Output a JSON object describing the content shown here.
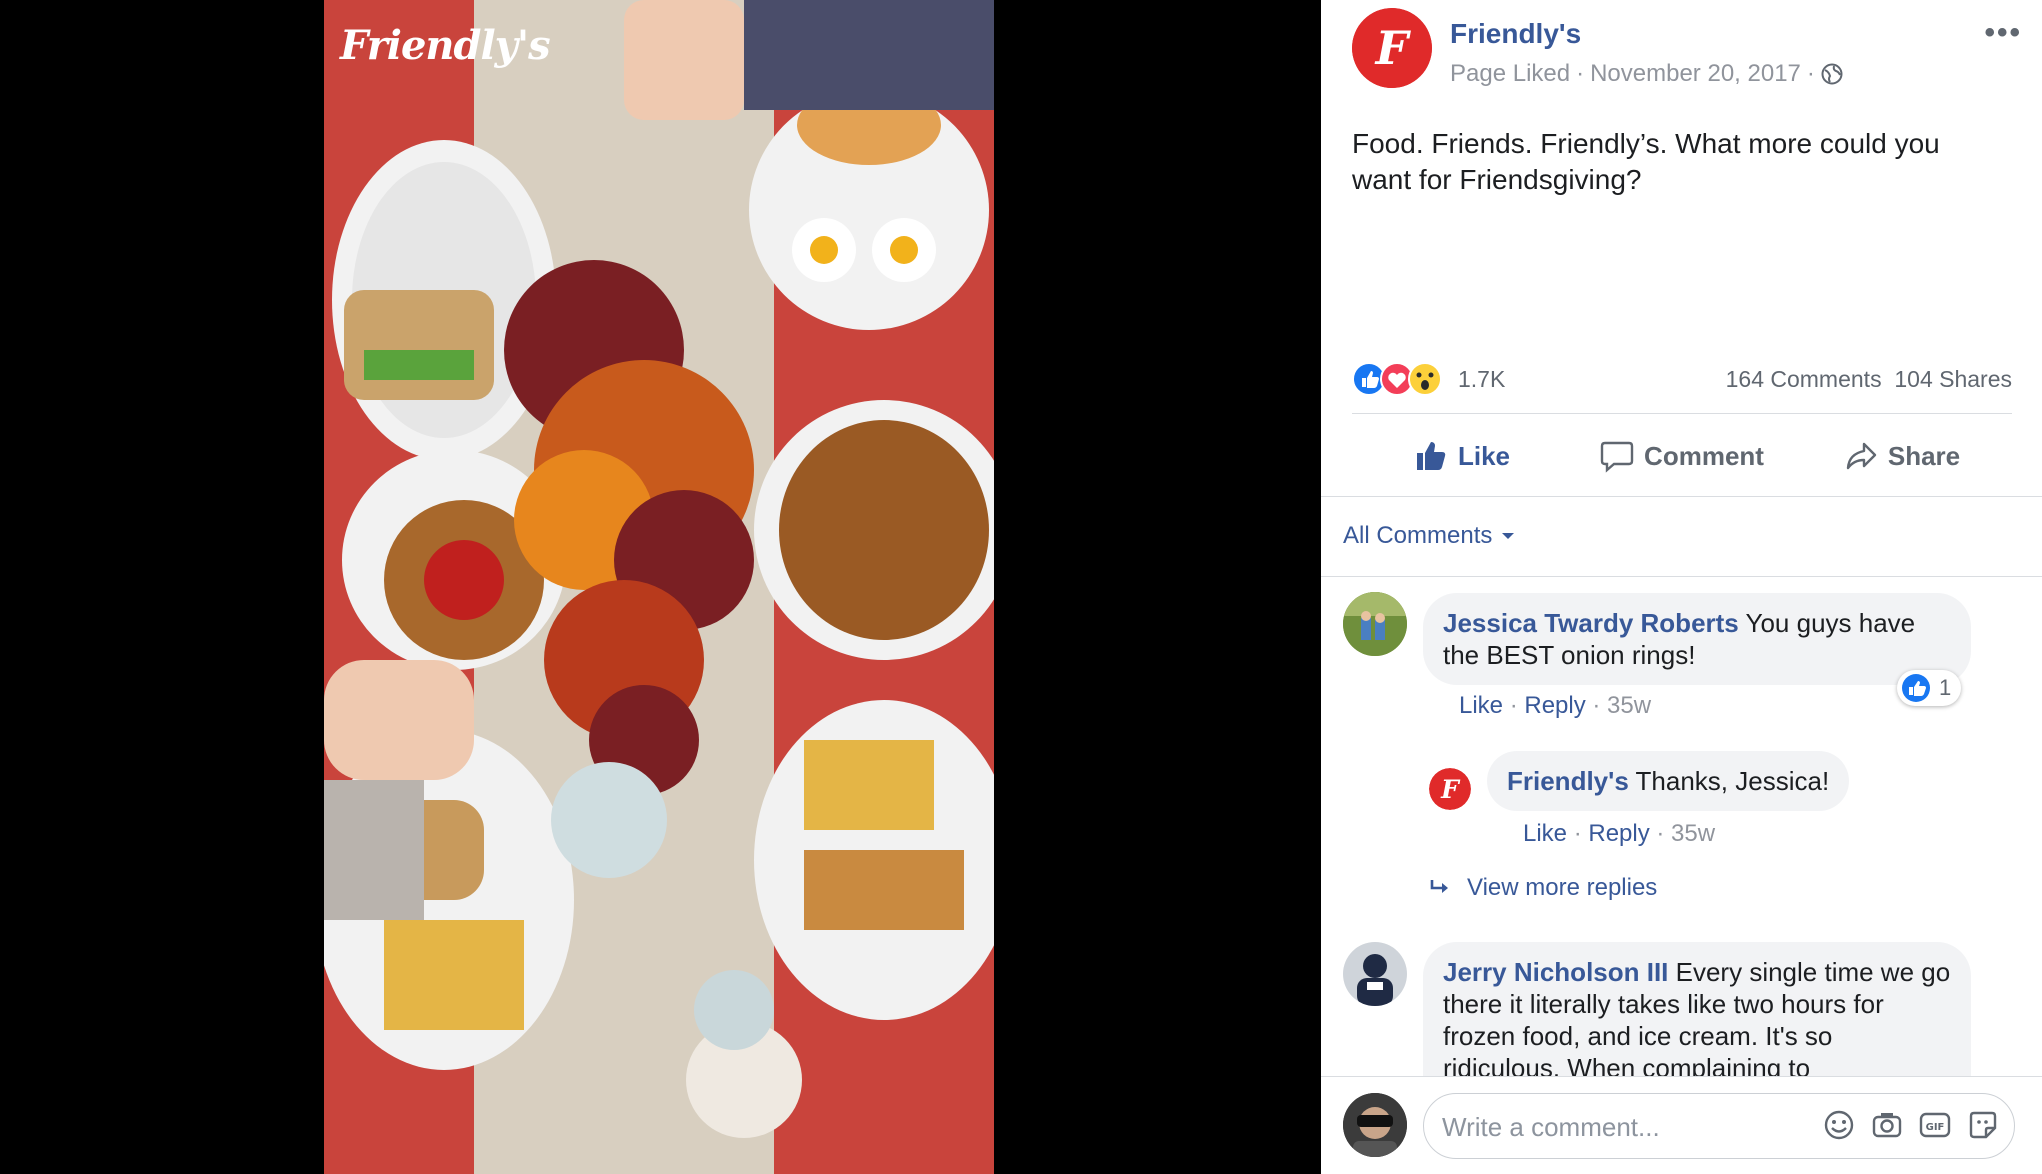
{
  "photo": {
    "logo_text": "Friendly's"
  },
  "post": {
    "page_name": "Friendly's",
    "liked_label": "Page Liked",
    "separator": "·",
    "date": "November 20, 2017",
    "more_label": "•••",
    "caption": "Food. Friends. Friendly’s. What more could you want for Friendsgiving?",
    "reaction_count": "1.7K",
    "comments_count": "164 Comments",
    "shares_count": "104 Shares"
  },
  "actions": {
    "like": "Like",
    "comment": "Comment",
    "share": "Share"
  },
  "comments_filter": "All Comments",
  "comments": [
    {
      "author": "Jessica Twardy Roberts",
      "text": " You guys have the BEST onion rings!",
      "like": "Like",
      "reply": "Reply",
      "time": "35w",
      "likes": "1"
    },
    {
      "author": "Friendly's",
      "text": " Thanks, Jessica!",
      "like": "Like",
      "reply": "Reply",
      "time": "35w"
    },
    {
      "author": "Jerry Nicholson III",
      "text": " Every single time we go there it literally takes like two hours for frozen food, and ice cream. It's so ridiculous. When complaining to"
    }
  ],
  "view_more_replies": "View more replies",
  "composer": {
    "placeholder": "Write a comment..."
  },
  "colors": {
    "accent": "#385898",
    "brand_red": "#e02a2a",
    "reaction_like": "#1877f2",
    "reaction_love": "#f33e58"
  },
  "icons": [
    "globe-icon",
    "like-thumb-icon",
    "comment-bubble-icon",
    "share-arrow-icon",
    "chevron-down-icon",
    "reply-arrow-icon",
    "emoji-icon",
    "camera-icon",
    "gif-icon",
    "sticker-icon"
  ]
}
